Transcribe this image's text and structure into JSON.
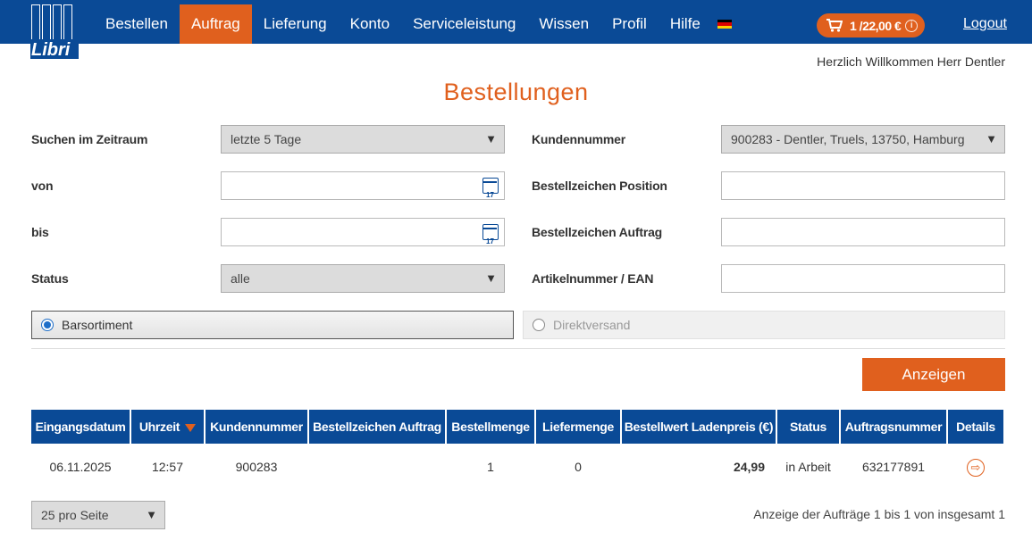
{
  "header": {
    "logo_text": "Libri",
    "nav": [
      "Bestellen",
      "Auftrag",
      "Lieferung",
      "Konto",
      "Serviceleistung",
      "Wissen",
      "Profil",
      "Hilfe"
    ],
    "active_nav": "Auftrag",
    "cart_label": "1 /22,00 €",
    "logout": "Logout",
    "accent_color": "#e0601e",
    "brand_color": "#0a4a96"
  },
  "welcome": "Herzlich Willkommen Herr Dentler",
  "page_title": "Bestellungen",
  "form": {
    "zeitraum_label": "Suchen im Zeitraum",
    "zeitraum_value": "letzte 5 Tage",
    "von_label": "von",
    "von_value": "",
    "bis_label": "bis",
    "bis_value": "",
    "status_label": "Status",
    "status_value": "alle",
    "kundennummer_label": "Kundennummer",
    "kundennummer_value": "900283 - Dentler, Truels, 13750, Hamburg",
    "position_label": "Bestellzeichen Position",
    "position_value": "",
    "auftrag_label": "Bestellzeichen Auftrag",
    "auftrag_value": "",
    "artikel_label": "Artikelnummer / EAN",
    "artikel_value": "",
    "radio_barsortiment": "Barsortiment",
    "radio_direktversand": "Direktversand",
    "calendar_day": "17",
    "submit": "Anzeigen"
  },
  "table": {
    "headers": [
      "Eingangsdatum",
      "Uhrzeit",
      "Kundennummer",
      "Bestellzeichen Auftrag",
      "Bestellmenge",
      "Liefermenge",
      "Bestellwert Ladenpreis (€)",
      "Status",
      "Auftragsnummer",
      "Details"
    ],
    "rows": [
      {
        "eingangsdatum": "06.11.2025",
        "uhrzeit": "12:57",
        "kundennummer": "900283",
        "bestellzeichen": "",
        "bestellmenge": "1",
        "liefermenge": "0",
        "bestellwert": "24,99",
        "status": "in Arbeit",
        "auftragsnummer": "632177891"
      }
    ]
  },
  "pager": {
    "per_page": "25 pro Seite",
    "summary": "Anzeige der Aufträge 1 bis 1 von insgesamt 1"
  }
}
